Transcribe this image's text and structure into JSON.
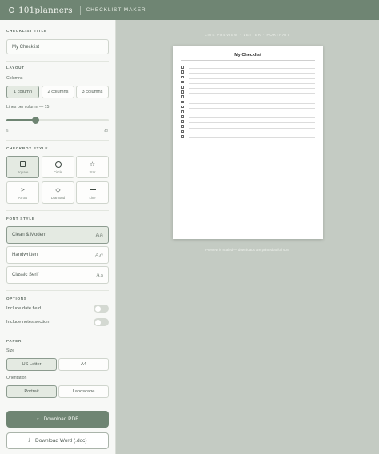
{
  "header": {
    "brand": "101planners",
    "app_title": "CHECKLIST MAKER"
  },
  "sidebar": {
    "checklist_title": {
      "label": "CHECKLIST TITLE",
      "value": "My Checklist"
    },
    "layout": {
      "label": "LAYOUT",
      "columns_label": "Columns",
      "columns": [
        "1 column",
        "2 columns",
        "3 columns"
      ],
      "selected_column": 0,
      "lines_label": "Lines per column — 15",
      "lines_value": 15,
      "lines_min": "5",
      "lines_max": "40"
    },
    "checkbox_style": {
      "label": "CHECKBOX STYLE",
      "options": [
        {
          "label": "Square",
          "icon": "square-icon"
        },
        {
          "label": "Circle",
          "icon": "circle-icon"
        },
        {
          "label": "Star",
          "icon": "star-icon"
        },
        {
          "label": "Arrow",
          "icon": "arrow-icon"
        },
        {
          "label": "Diamond",
          "icon": "diamond-icon"
        },
        {
          "label": "Line",
          "icon": "line-icon"
        }
      ],
      "selected": 0
    },
    "font_style": {
      "label": "FONT STYLE",
      "options": [
        {
          "name": "Clean & Modern",
          "sample": "Aa"
        },
        {
          "name": "Handwritten",
          "sample": "Aa"
        },
        {
          "name": "Classic Serif",
          "sample": "Aa"
        }
      ],
      "selected": 0
    },
    "options": {
      "label": "OPTIONS",
      "date_field": "Include date field",
      "date_field_on": false,
      "notes_section": "Include notes section",
      "notes_section_on": false
    },
    "paper": {
      "label": "PAPER",
      "size_label": "Size",
      "sizes": [
        "US Letter",
        "A4"
      ],
      "selected_size": 0,
      "orientation_label": "Orientation",
      "orientations": [
        "Portrait",
        "Landscape"
      ],
      "selected_orientation": 0
    },
    "actions": {
      "download_pdf": "Download PDF",
      "download_word": "Download Word (.doc)"
    }
  },
  "preview": {
    "label": "LIVE PREVIEW · LETTER · PORTRAIT",
    "paper_title": "My Checklist",
    "rows": 15,
    "note": "Preview is scaled — downloads are printed at full size"
  },
  "colors": {
    "accent": "#6f8573",
    "background": "#c4cbc3",
    "sidebar": "#f7f8f6"
  }
}
